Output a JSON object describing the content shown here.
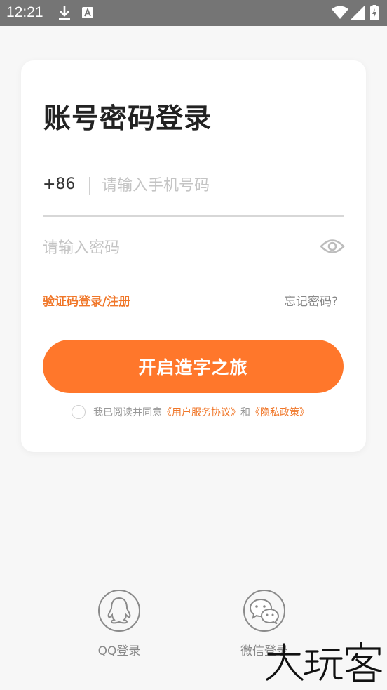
{
  "status_bar": {
    "time": "12:21",
    "icons": [
      "download-icon",
      "a-icon",
      "wifi-icon",
      "signal-icon",
      "battery-icon"
    ]
  },
  "login": {
    "title": "账号密码登录",
    "country_code": "+86",
    "phone_placeholder": "请输入手机号码",
    "password_placeholder": "请输入密码",
    "sms_login_link": "验证码登录/注册",
    "forgot_password_link": "忘记密码?",
    "submit_label": "开启造字之旅",
    "agreement": {
      "prefix": "我已阅读并同意",
      "user_agreement": "《用户服务协议》",
      "connector": "和",
      "privacy_policy": "《隐私政策》"
    }
  },
  "social_login": {
    "qq_label": "QQ登录",
    "wechat_label": "微信登录"
  },
  "watermark": "大玩客",
  "colors": {
    "accent": "#ff772b",
    "link": "#f07628",
    "status_bar": "#757575",
    "background": "#f7f7f7"
  }
}
